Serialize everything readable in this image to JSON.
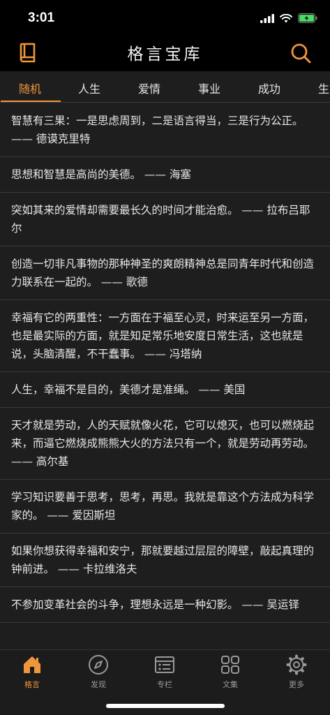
{
  "status": {
    "time": "3:01"
  },
  "colors": {
    "accent": "#f0963c",
    "background": "#1e1e1e",
    "bar": "#000000"
  },
  "nav": {
    "title": "格言宝库",
    "left_icon": "book-icon",
    "right_icon": "search-icon"
  },
  "tabs": [
    {
      "label": "随机",
      "active": true
    },
    {
      "label": "人生"
    },
    {
      "label": "爱情"
    },
    {
      "label": "事业"
    },
    {
      "label": "成功"
    },
    {
      "label": "生"
    }
  ],
  "quotes": [
    "智慧有三果：一是思虑周到，二是语言得当，三是行为公正。 —— 德谟克里特",
    "思想和智慧是高尚的美德。 —— 海塞",
    "突如其来的爱情却需要最长久的时间才能治愈。 —— 拉布吕耶尔",
    "创造一切非凡事物的那种神圣的爽朗精神总是同青年时代和创造力联系在一起的。 —— 歌德",
    "幸福有它的两重性：一方面在于福至心灵，时来运至另一方面，也是最实际的方面，就是知足常乐地安度日常生活，这也就是说，头脑清醒，不干蠢事。 —— 冯塔纳",
    "人生，幸福不是目的，美德才是准绳。 —— 美国",
    "天才就是劳动，人的天赋就像火花，它可以熄灭，也可以燃烧起来，而逼它燃烧成熊熊大火的方法只有一个，就是劳动再劳动。 —— 高尔基",
    "学习知识要善于思考，思考，再思。我就是靠这个方法成为科学家的。 —— 爱因斯坦",
    "如果你想获得幸福和安宁，那就要越过层层的障壁，敲起真理的钟前进。 —— 卡拉维洛夫",
    "不参加变革社会的斗争，理想永远是一种幻影。 —— 吴运铎"
  ],
  "tabbar": [
    {
      "label": "格言",
      "icon": "home-icon",
      "active": true
    },
    {
      "label": "发现",
      "icon": "compass-icon"
    },
    {
      "label": "专栏",
      "icon": "column-icon"
    },
    {
      "label": "文集",
      "icon": "grid-icon"
    },
    {
      "label": "更多",
      "icon": "gear-icon"
    }
  ]
}
